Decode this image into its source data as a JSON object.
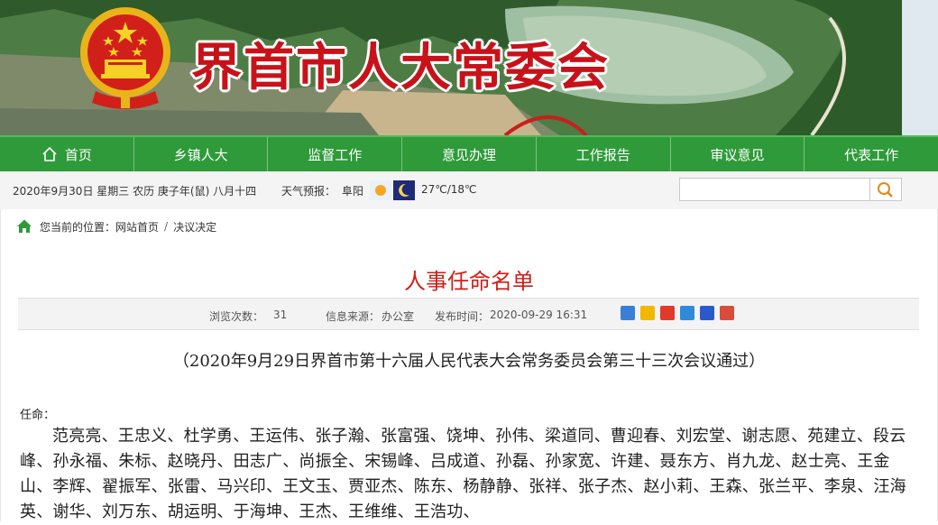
{
  "header": {
    "site_title": "界首市人大常委会"
  },
  "nav": {
    "items": [
      {
        "label": "首页"
      },
      {
        "label": "乡镇人大"
      },
      {
        "label": "监督工作"
      },
      {
        "label": "意见办理"
      },
      {
        "label": "工作报告"
      },
      {
        "label": "审议意见"
      },
      {
        "label": "代表工作"
      }
    ]
  },
  "infobar": {
    "date": "2020年9月30日 星期三 农历 庚子年(鼠) 八月十四",
    "weather_label": "天气预报：",
    "weather_city": "阜阳",
    "temperature": "27℃/18℃",
    "search_placeholder": ""
  },
  "breadcrumb": {
    "prefix": "您当前的位置：",
    "home": "网站首页",
    "separator": "/",
    "current": "决议决定"
  },
  "article": {
    "title": "人事任命名单",
    "meta": {
      "views_label": "浏览次数：",
      "views": "31",
      "source_label": "信息来源：",
      "source": "办公室",
      "time_label": "发布时间：",
      "time": "2020-09-29 16:31"
    },
    "subtitle": "（2020年9月29日界首市第十六届人民代表大会常务委员会第三十三次会议通过）",
    "appoint_label": "任命：",
    "names": "范亮亮、王忠义、杜学勇、王运伟、张子瀚、张富强、饶坤、孙伟、梁道同、曹迎春、刘宏堂、谢志愿、苑建立、段云峰、孙永福、朱标、赵晓丹、田志广、尚振全、宋锡峰、吕成道、孙磊、孙家宽、许建、聂东方、肖九龙、赵士亮、王金山、李辉、翟振军、张雷、马兴印、王文玉、贾亚杰、陈东、杨静静、张祥、张子杰、赵小莉、王森、张兰平、李泉、汪海英、谢华、刘万东、胡运明、于海坤、王杰、王维维、王浩功、"
  },
  "colors": {
    "nav_green": "#2f9a3a",
    "title_red": "#d21d16",
    "brand_red": "#c8121a"
  },
  "icons": [
    "national-emblem",
    "home-icon",
    "weather-sun-icon",
    "weather-moon-icon",
    "search-icon",
    "share-icons"
  ]
}
